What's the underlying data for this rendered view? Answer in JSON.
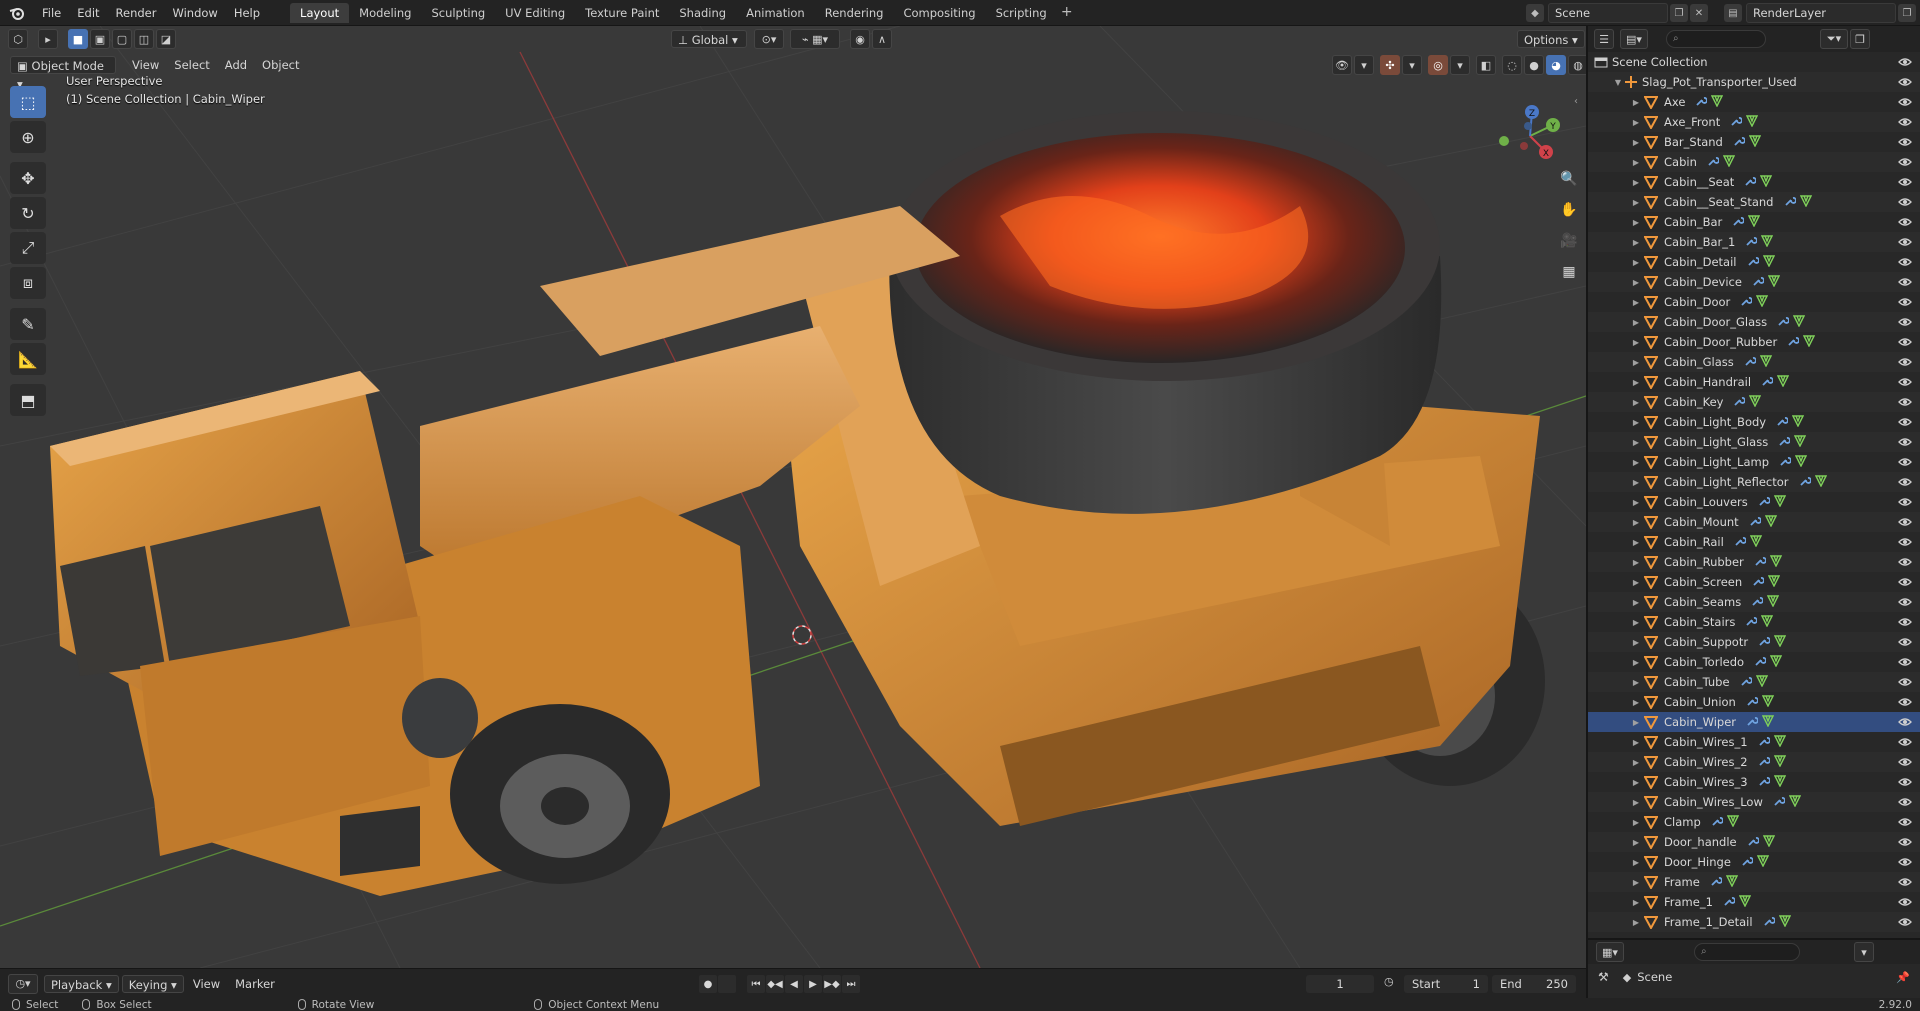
{
  "topbar": {
    "menus": [
      "File",
      "Edit",
      "Render",
      "Window",
      "Help"
    ],
    "workspaces": [
      {
        "label": "Layout",
        "active": true
      },
      {
        "label": "Modeling",
        "active": false
      },
      {
        "label": "Sculpting",
        "active": false
      },
      {
        "label": "UV Editing",
        "active": false
      },
      {
        "label": "Texture Paint",
        "active": false
      },
      {
        "label": "Shading",
        "active": false
      },
      {
        "label": "Animation",
        "active": false
      },
      {
        "label": "Rendering",
        "active": false
      },
      {
        "label": "Compositing",
        "active": false
      },
      {
        "label": "Scripting",
        "active": false
      }
    ],
    "add_workspace": "+",
    "scene_name": "Scene",
    "render_layer": "RenderLayer"
  },
  "viewport": {
    "mode": "Object Mode",
    "menus": [
      "View",
      "Select",
      "Add",
      "Object"
    ],
    "transform_orientation": "Global",
    "options_label": "Options",
    "info_line1": "User Perspective",
    "info_line2": "(1) Scene Collection | Cabin_Wiper",
    "gizmo_axes": {
      "x": "X",
      "y": "Y",
      "z": "Z"
    }
  },
  "outliner": {
    "root_label": "Scene Collection",
    "object_label": "Slag_Pot_Transporter_Used",
    "selected": "Cabin_Wiper",
    "items": [
      "Axe",
      "Axe_Front",
      "Bar_Stand",
      "Cabin",
      "Cabin__Seat",
      "Cabin__Seat_Stand",
      "Cabin_Bar",
      "Cabin_Bar_1",
      "Cabin_Detail",
      "Cabin_Device",
      "Cabin_Door",
      "Cabin_Door_Glass",
      "Cabin_Door_Rubber",
      "Cabin_Glass",
      "Cabin_Handrail",
      "Cabin_Key",
      "Cabin_Light_Body",
      "Cabin_Light_Glass",
      "Cabin_Light_Lamp",
      "Cabin_Light_Reflector",
      "Cabin_Louvers",
      "Cabin_Mount",
      "Cabin_Rail",
      "Cabin_Rubber",
      "Cabin_Screen",
      "Cabin_Seams",
      "Cabin_Stairs",
      "Cabin_Suppotr",
      "Cabin_Torledo",
      "Cabin_Tube",
      "Cabin_Union",
      "Cabin_Wiper",
      "Cabin_Wires_1",
      "Cabin_Wires_2",
      "Cabin_Wires_3",
      "Cabin_Wires_Low",
      "Clamp",
      "Door_handle",
      "Door_Hinge",
      "Frame",
      "Frame_1",
      "Frame_1_Detail"
    ]
  },
  "properties": {
    "scene_label": "Scene"
  },
  "timeline": {
    "menus": [
      "Playback",
      "Keying",
      "View",
      "Marker"
    ],
    "current_frame": "1",
    "start_label": "Start",
    "start_value": "1",
    "end_label": "End",
    "end_value": "250"
  },
  "statusbar": {
    "select": "Select",
    "box_select": "Box Select",
    "rotate_view": "Rotate View",
    "context_menu": "Object Context Menu",
    "version": "2.92.0"
  },
  "colors": {
    "accent": "#4772b3",
    "object_orange": "#f0983c",
    "modifier_blue": "#6fa3e0",
    "mesh_green": "#7fd05a",
    "lava": "#ff5a1a",
    "machine_yellow": "#d9932f"
  }
}
